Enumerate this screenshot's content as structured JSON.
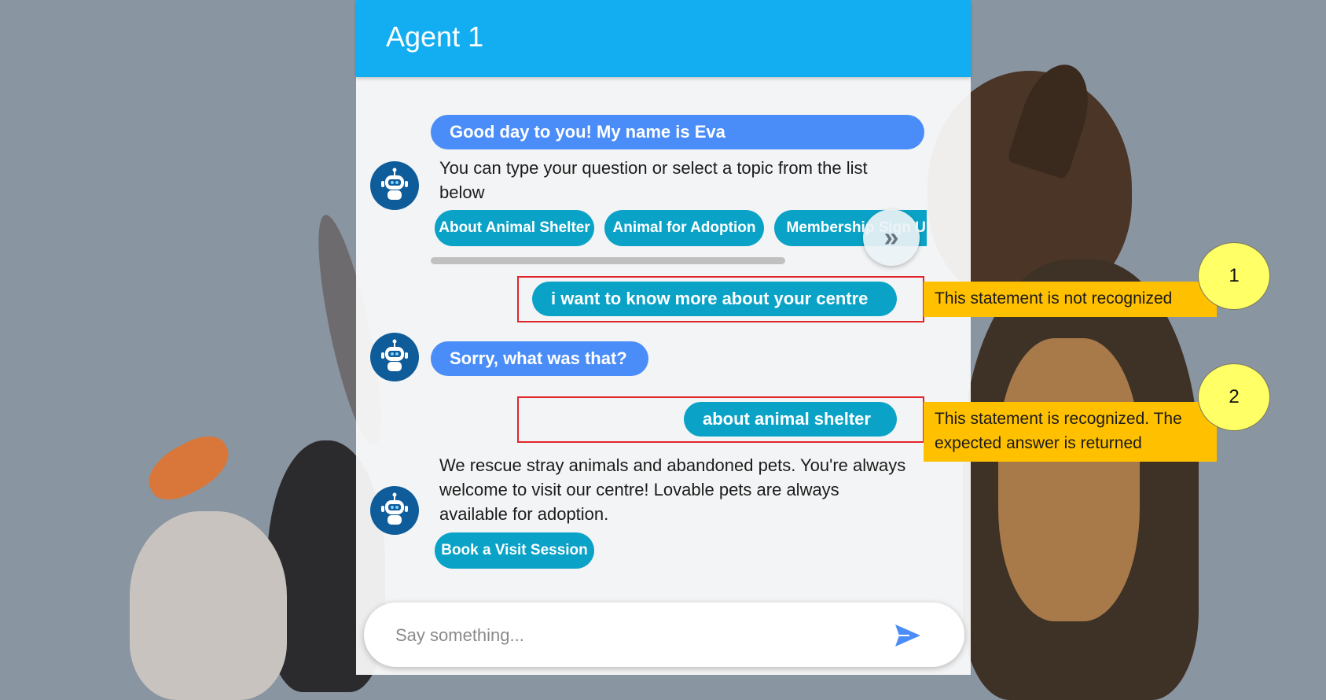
{
  "colors": {
    "header": "#13aef2",
    "bot_bubble": "#4b8df8",
    "user_bubble": "#0aa3c7",
    "chip": "#0aa3c7",
    "highlight_box": "#e2252b",
    "note_bg": "#ffc000",
    "badge_bg": "#ffff66"
  },
  "header": {
    "title": "Agent 1"
  },
  "messages": {
    "greeting": "Good day to you! My name is Eva",
    "intro": "You can type your question or select a topic from the list below",
    "chips": [
      "About Animal Shelter",
      "Animal for Adoption",
      "Membership Sign Up"
    ],
    "next_icon": "double-chevron-right-icon",
    "user_1": "i want to know more about your centre",
    "bot_sorry": "Sorry, what was that?",
    "user_2": "about animal shelter",
    "answer": "We rescue stray animals and abandoned pets. You're always welcome to visit our centre! Lovable pets are always available for adoption.",
    "answer_chip": "Book a Visit Session"
  },
  "input": {
    "placeholder": "Say something...",
    "send_icon": "send-icon"
  },
  "annotations": [
    {
      "badge": "1",
      "note": "This statement is not recognized"
    },
    {
      "badge": "2",
      "note": "This statement is recognized. The expected answer is returned"
    }
  ]
}
